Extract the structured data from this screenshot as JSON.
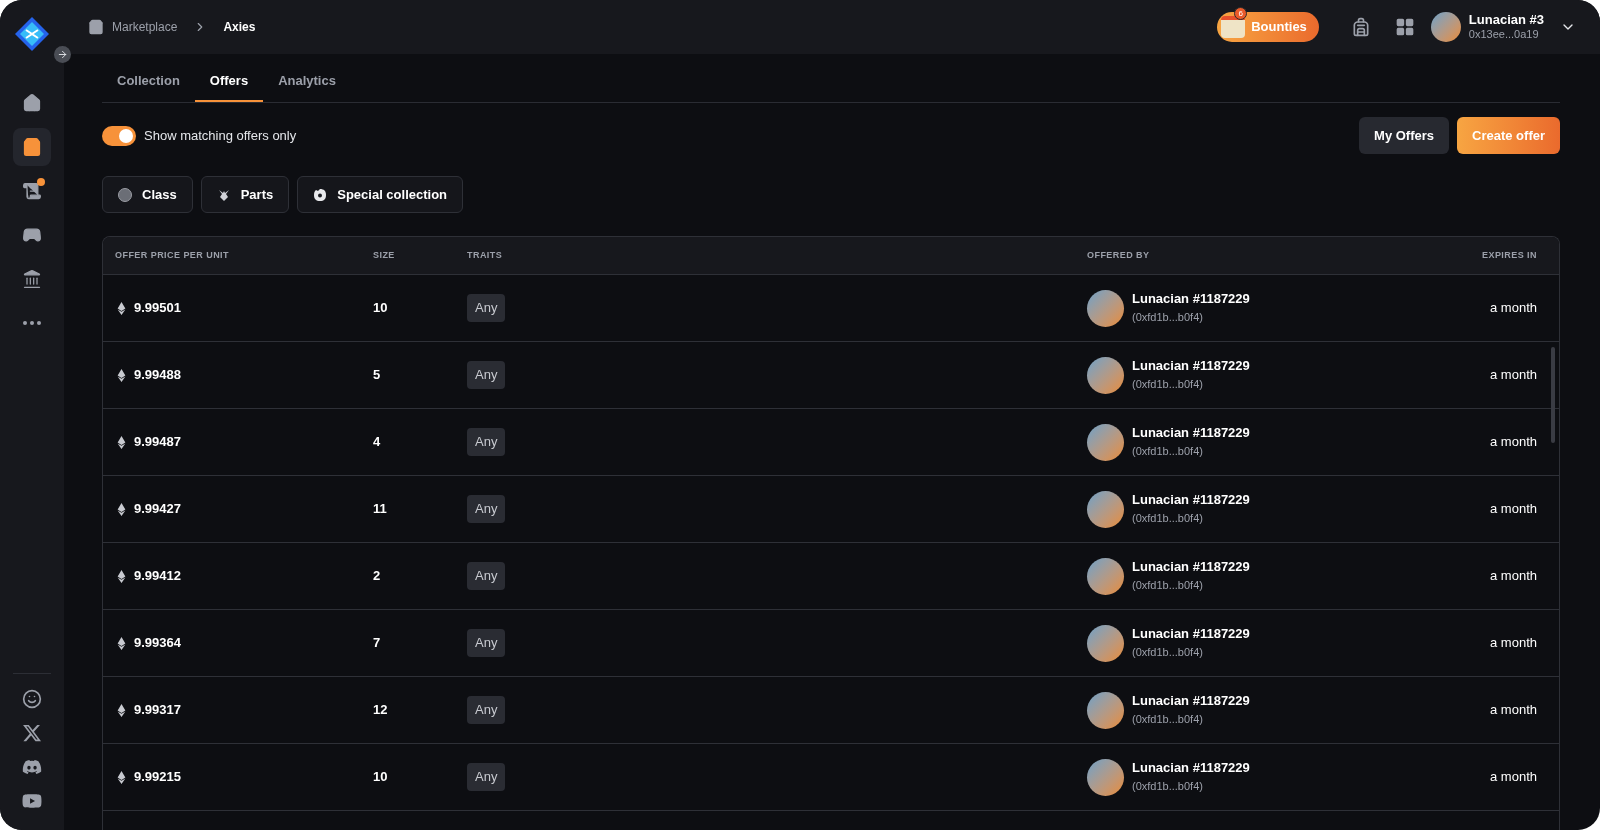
{
  "breadcrumb": [
    {
      "label": "Marketplace"
    },
    {
      "label": "Axies"
    }
  ],
  "bounties": {
    "label": "Bounties",
    "count": "6"
  },
  "user": {
    "name": "Lunacian #3",
    "address": "0x13ee...0a19"
  },
  "sidebar": {
    "items": [
      {
        "kind": "home",
        "selected": false,
        "notify": false
      },
      {
        "kind": "bag",
        "selected": true,
        "notify": false
      },
      {
        "kind": "quests",
        "selected": false,
        "notify": true
      },
      {
        "kind": "games",
        "selected": false,
        "notify": false
      },
      {
        "kind": "bank",
        "selected": false,
        "notify": false
      },
      {
        "kind": "more",
        "selected": false,
        "notify": false
      }
    ],
    "social": [
      {
        "kind": "chat"
      },
      {
        "kind": "x"
      },
      {
        "kind": "discord"
      },
      {
        "kind": "youtube"
      }
    ]
  },
  "tabs": [
    {
      "label": "Collection",
      "selected": false
    },
    {
      "label": "Offers",
      "selected": true
    },
    {
      "label": "Analytics",
      "selected": false
    }
  ],
  "toggle": {
    "label": "Show matching offers only",
    "on": true
  },
  "actions": [
    {
      "label": "My Offers",
      "kind": "secondary"
    },
    {
      "label": "Create offer",
      "kind": "primary"
    }
  ],
  "filters": [
    {
      "label": "Class",
      "kind": "class"
    },
    {
      "label": "Parts",
      "kind": "parts"
    },
    {
      "label": "Special collection",
      "kind": "special"
    }
  ],
  "table": {
    "columns": [
      "OFFER PRICE PER UNIT",
      "SIZE",
      "TRAITS",
      "OFFERED BY",
      "EXPIRES IN"
    ],
    "rows": [
      {
        "price": "9.99501",
        "size": "10",
        "traits": "Any",
        "name": "Lunacian #1187229",
        "address": "(0xfd1b...b0f4)",
        "expires": "a month"
      },
      {
        "price": "9.99488",
        "size": "5",
        "traits": "Any",
        "name": "Lunacian #1187229",
        "address": "(0xfd1b...b0f4)",
        "expires": "a month"
      },
      {
        "price": "9.99487",
        "size": "4",
        "traits": "Any",
        "name": "Lunacian #1187229",
        "address": "(0xfd1b...b0f4)",
        "expires": "a month"
      },
      {
        "price": "9.99427",
        "size": "11",
        "traits": "Any",
        "name": "Lunacian #1187229",
        "address": "(0xfd1b...b0f4)",
        "expires": "a month"
      },
      {
        "price": "9.99412",
        "size": "2",
        "traits": "Any",
        "name": "Lunacian #1187229",
        "address": "(0xfd1b...b0f4)",
        "expires": "a month"
      },
      {
        "price": "9.99364",
        "size": "7",
        "traits": "Any",
        "name": "Lunacian #1187229",
        "address": "(0xfd1b...b0f4)",
        "expires": "a month"
      },
      {
        "price": "9.99317",
        "size": "12",
        "traits": "Any",
        "name": "Lunacian #1187229",
        "address": "(0xfd1b...b0f4)",
        "expires": "a month"
      },
      {
        "price": "9.99215",
        "size": "10",
        "traits": "Any",
        "name": "Lunacian #1187229",
        "address": "(0xfd1b...b0f4)",
        "expires": "a month"
      }
    ]
  }
}
